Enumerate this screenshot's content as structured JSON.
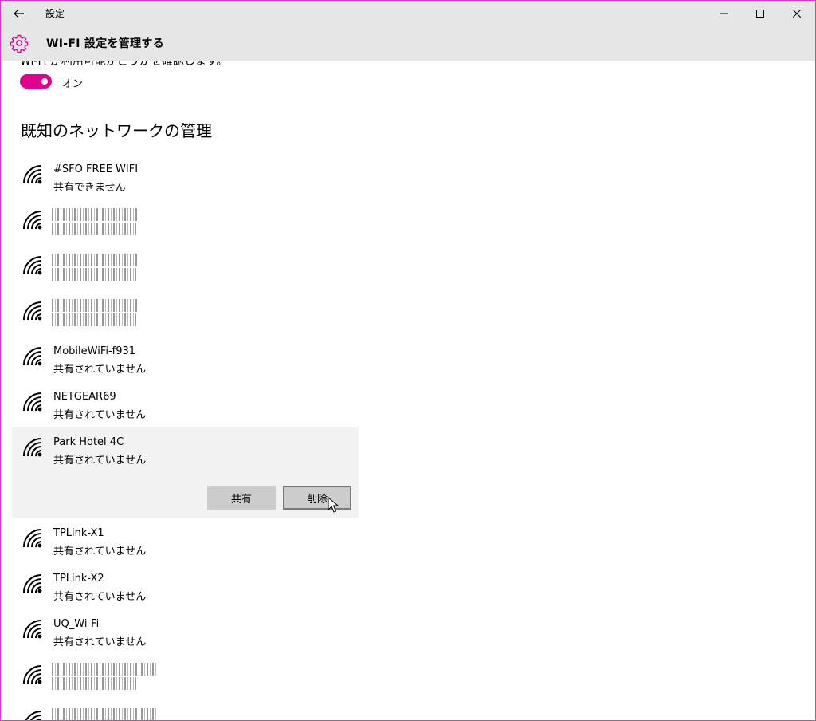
{
  "window": {
    "app_title": "設定",
    "icons": {
      "back": "back-arrow-icon",
      "minimize": "minimize-icon",
      "maximize": "maximize-icon",
      "close": "close-icon"
    }
  },
  "header": {
    "title": "WI-FI 設定を管理する",
    "icon": "gear-icon",
    "accent_color": "#e3008c"
  },
  "wifi_sense": {
    "cut_off_text": "Wi-Fi が利用可能かどうかを確認します。",
    "toggle_state_label": "オン",
    "toggle_on": true
  },
  "known_networks": {
    "section_title": "既知のネットワークの管理",
    "items": [
      {
        "name": "#SFO FREE WIFI",
        "status": "共有できません",
        "redacted": false
      },
      {
        "name": "",
        "status": "",
        "redacted": true
      },
      {
        "name": "",
        "status": "",
        "redacted": true
      },
      {
        "name": "",
        "status": "",
        "redacted": true
      },
      {
        "name": "MobileWiFi-f931",
        "status": "共有されていません",
        "redacted": false
      },
      {
        "name": "NETGEAR69",
        "status": "共有されていません",
        "redacted": false
      },
      {
        "name": "Park Hotel 4C",
        "status": "共有されていません",
        "redacted": false,
        "selected": true
      },
      {
        "name": "TPLink-X1",
        "status": "共有されていません",
        "redacted": false
      },
      {
        "name": "TPLink-X2",
        "status": "共有されていません",
        "redacted": false
      },
      {
        "name": "UQ_Wi-Fi",
        "status": "共有されていません",
        "redacted": false
      },
      {
        "name": "",
        "status": "",
        "redacted": true
      },
      {
        "name": "",
        "status": "",
        "redacted": true
      }
    ],
    "selected_actions": {
      "share_label": "共有",
      "delete_label": "削除"
    }
  }
}
